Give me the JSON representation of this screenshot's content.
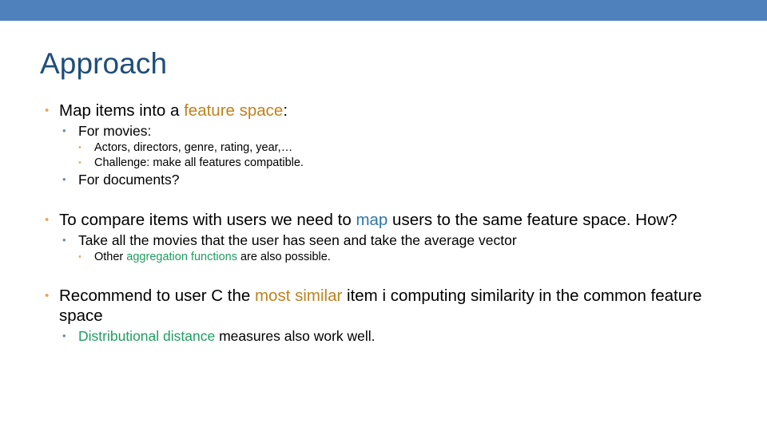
{
  "slide": {
    "title": "Approach",
    "accent_bar_color": "#4F81BD",
    "title_color": "#1F4E79",
    "background_color": "#FFFFFF",
    "highlight_colors": {
      "orange": "#C0811F",
      "green": "#1F9E5E",
      "blue": "#2E75A8"
    },
    "bullet_marker_colors": {
      "level1": "#E8A55C",
      "level2": "#6F8CAD",
      "level3": "#E0B07A"
    },
    "bullet_glyph": "•"
  },
  "content": {
    "group1": {
      "b1": {
        "pre": "Map items into a ",
        "highlight": "feature space",
        "post": ":"
      },
      "b2": "For movies:",
      "b3": "Actors, directors, genre, rating, year,…",
      "b4": "Challenge: make all features compatible.",
      "b5": "For documents?"
    },
    "group2": {
      "b1": {
        "pre": "To compare items with users we need to ",
        "highlight": "map",
        "post": " users to the same feature space. How?"
      },
      "b2": "Take all the movies that the user has seen and take the average vector",
      "b3": {
        "pre": "Other ",
        "highlight": "aggregation functions",
        "post": " are also possible."
      }
    },
    "group3": {
      "b1": {
        "pre": "Recommend to user C the ",
        "highlight": "most similar",
        "post": " item i computing similarity in the common feature space"
      },
      "b2": {
        "highlight": "Distributional distance",
        "post": " measures also work well."
      }
    }
  }
}
